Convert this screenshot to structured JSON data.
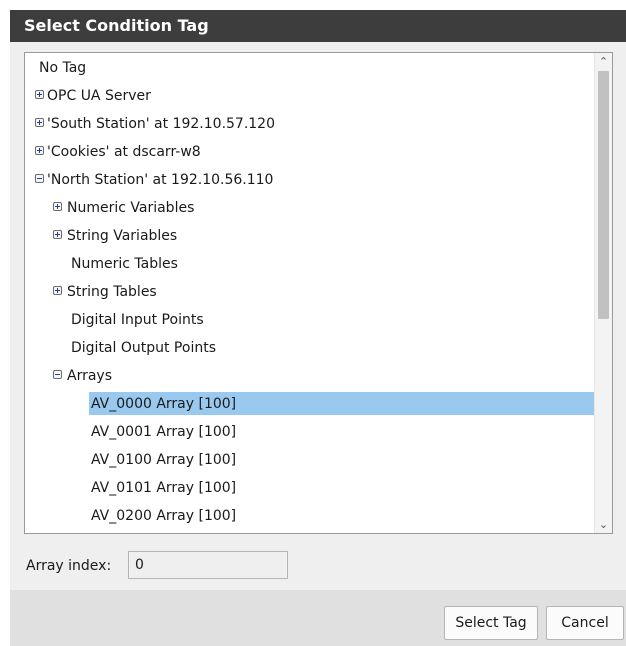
{
  "dialog": {
    "title": "Select Condition Tag"
  },
  "tree": {
    "items": [
      {
        "label": "No Tag",
        "level": 0,
        "expander": "none",
        "selected": false
      },
      {
        "label": "OPC UA Server",
        "level": 0,
        "expander": "plus",
        "selected": false
      },
      {
        "label": "'South Station' at 192.10.57.120",
        "level": 0,
        "expander": "plus",
        "selected": false
      },
      {
        "label": "'Cookies' at dscarr-w8",
        "level": 0,
        "expander": "plus",
        "selected": false
      },
      {
        "label": "'North Station' at 192.10.56.110",
        "level": 0,
        "expander": "minus",
        "selected": false
      },
      {
        "label": "Numeric Variables",
        "level": 1,
        "expander": "plus",
        "selected": false
      },
      {
        "label": "String Variables",
        "level": 1,
        "expander": "plus",
        "selected": false
      },
      {
        "label": "Numeric Tables",
        "level": 1,
        "expander": "none",
        "selected": false
      },
      {
        "label": "String Tables",
        "level": 1,
        "expander": "plus",
        "selected": false
      },
      {
        "label": "Digital Input Points",
        "level": 1,
        "expander": "none",
        "selected": false
      },
      {
        "label": "Digital Output Points",
        "level": 1,
        "expander": "none",
        "selected": false
      },
      {
        "label": "Arrays",
        "level": 1,
        "expander": "minus",
        "selected": false
      },
      {
        "label": "AV_0000 Array [100]",
        "level": 2,
        "expander": "none",
        "selected": true
      },
      {
        "label": "AV_0001 Array [100]",
        "level": 2,
        "expander": "none",
        "selected": false
      },
      {
        "label": "AV_0100 Array [100]",
        "level": 2,
        "expander": "none",
        "selected": false
      },
      {
        "label": "AV_0101 Array [100]",
        "level": 2,
        "expander": "none",
        "selected": false
      },
      {
        "label": "AV_0200 Array [100]",
        "level": 2,
        "expander": "none",
        "selected": false
      }
    ]
  },
  "array_index": {
    "label": "Array index:",
    "value": "0"
  },
  "buttons": {
    "select_tag": "Select Tag",
    "cancel": "Cancel"
  },
  "colors": {
    "titlebar": "#3d3d3d",
    "selection": "#99c9ef",
    "dialog_bg": "#efefef",
    "footer_bg": "#e0e0e0"
  }
}
